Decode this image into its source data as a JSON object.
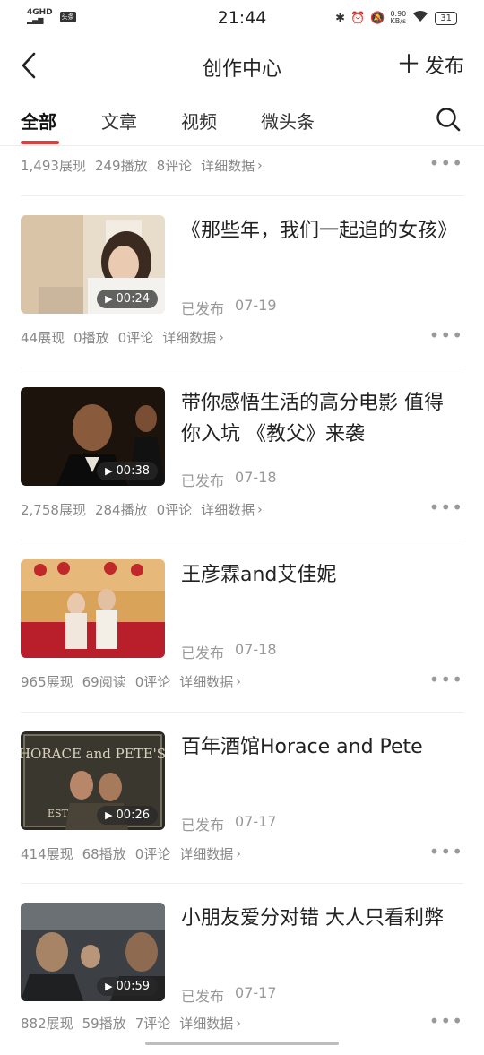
{
  "status_bar": {
    "network": "4GHD",
    "signal": "▂▄▆",
    "app_badge": "头条",
    "time": "21:44",
    "speed_value": "0.90",
    "speed_unit": "KB/s",
    "battery": "31"
  },
  "nav": {
    "title": "创作中心",
    "publish_label": "发布"
  },
  "tabs": [
    {
      "label": "全部",
      "active": true
    },
    {
      "label": "文章"
    },
    {
      "label": "视频"
    },
    {
      "label": "微头条"
    }
  ],
  "top_partial": {
    "views": "1,493展现",
    "plays": "249播放",
    "comments": "8评论",
    "detail": "详细数据"
  },
  "items": [
    {
      "title": "《那些年，我们一起追的女孩》",
      "status": "已发布",
      "date": "07-19",
      "duration": "00:24",
      "views": "44展现",
      "plays": "0播放",
      "comments": "0评论",
      "detail": "详细数据",
      "thumb_icon": "girl-writing-thumbnail"
    },
    {
      "title": "带你感悟生活的高分电影 值得你入坑 《教父》来袭",
      "status": "已发布",
      "date": "07-18",
      "duration": "00:38",
      "views": "2,758展现",
      "plays": "284播放",
      "comments": "0评论",
      "detail": "详细数据",
      "thumb_icon": "godfather-thumbnail"
    },
    {
      "title": "王彦霖and艾佳妮",
      "status": "已发布",
      "date": "07-18",
      "duration": "",
      "views": "965展现",
      "plays": "69阅读",
      "comments": "0评论",
      "detail": "详细数据",
      "thumb_icon": "wedding-photo-thumbnail"
    },
    {
      "title": "百年酒馆Horace and Pete",
      "status": "已发布",
      "date": "07-17",
      "duration": "00:26",
      "views": "414展现",
      "plays": "68播放",
      "comments": "0评论",
      "detail": "详细数据",
      "thumb_icon": "horace-and-petes-thumbnail",
      "sign_text": "HORACE and PETE'S",
      "sign_est": "EST"
    },
    {
      "title": "小朋友爱分对错 大人只看利弊",
      "status": "已发布",
      "date": "07-17",
      "duration": "00:59",
      "views": "882展现",
      "plays": "59播放",
      "comments": "7评论",
      "detail": "详细数据",
      "thumb_icon": "car-scene-thumbnail"
    }
  ]
}
